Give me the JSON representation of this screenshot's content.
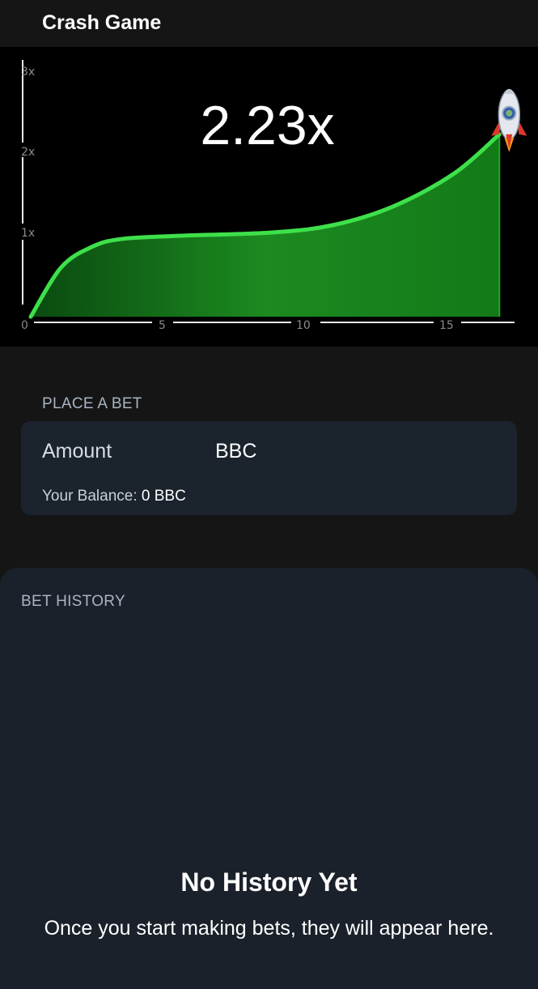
{
  "header": {
    "title": "Crash Game"
  },
  "game": {
    "multiplier": "2.23x",
    "current_multiplier": 2.23,
    "current_time": 15.5,
    "y_ticks": [
      "3x",
      "2x",
      "1x"
    ],
    "x_ticks": [
      "0",
      "5",
      "10",
      "15"
    ],
    "colors": {
      "curve": "#3ee04a",
      "fill_dark": "#0d5a13",
      "fill_light": "#1f8a22",
      "background": "#000000"
    }
  },
  "chart_data": {
    "type": "area",
    "x": [
      0,
      1,
      2,
      3,
      5,
      8,
      10,
      12,
      14,
      15.5
    ],
    "values": [
      0,
      0.6,
      0.85,
      0.95,
      0.99,
      1.03,
      1.12,
      1.35,
      1.75,
      2.23
    ],
    "xlim": [
      0,
      16
    ],
    "ylim": [
      0,
      3
    ],
    "x_tick_labels": [
      "0",
      "5",
      "10",
      "15"
    ],
    "y_tick_labels": [
      "1x",
      "2x",
      "3x"
    ]
  },
  "bet": {
    "section_label": "PLACE A BET",
    "amount_label": "Amount",
    "amount_value": "",
    "currency": "BBC",
    "balance_label": "Your Balance:",
    "balance_value": "0 BBC"
  },
  "history": {
    "section_label": "BET HISTORY",
    "empty_title": "No History Yet",
    "empty_message": "Once you start making bets, they will appear here."
  }
}
